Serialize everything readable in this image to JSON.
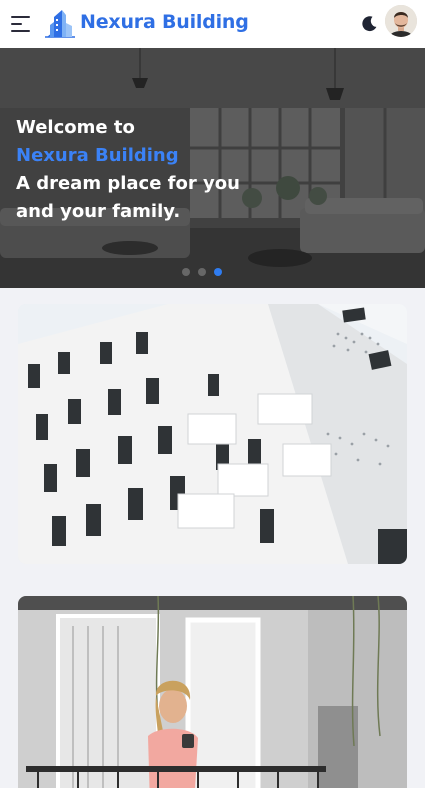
{
  "header": {
    "brand": "Nexura Building",
    "menu_icon": "hamburger-menu-icon",
    "theme_icon": "moon-icon",
    "avatar_icon": "user-avatar"
  },
  "hero": {
    "line1": "Welcome to",
    "line2": "Nexura Building",
    "line3": "A dream place for you",
    "line4": "and your family.",
    "slides": 3,
    "active_slide": 3
  },
  "cards": [
    {
      "subject": "white modern apartment building facade"
    },
    {
      "subject": "woman with phone on balcony"
    }
  ],
  "colors": {
    "accent": "#2f6fe4",
    "header_bg": "#ffffff",
    "page_bg": "#f1f2f6",
    "active_dot": "#2f7cf0"
  }
}
